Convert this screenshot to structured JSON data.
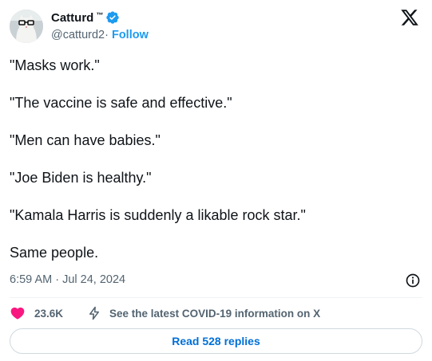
{
  "author": {
    "display_name": "Catturd",
    "tm": "™",
    "handle": "@catturd2",
    "separator": " ·",
    "follow_label": "Follow"
  },
  "tweet": {
    "lines": [
      "\"Masks work.\"",
      "\"The vaccine is safe and effective.\"",
      "\"Men can have babies.\"",
      "\"Joe Biden is healthy.\"",
      "\"Kamala Harris is suddenly a likable rock star.\"",
      "Same people."
    ]
  },
  "meta": {
    "timestamp": "6:59 AM · Jul 24, 2024"
  },
  "actions": {
    "like_count": "23.6K",
    "covid_info": "See the latest COVID-19 information on X",
    "read_replies": "Read 528 replies"
  },
  "icons": {
    "verified": "verified-badge-icon",
    "logo": "x-logo-icon",
    "info": "info-icon",
    "like": "heart-icon",
    "covid": "bolt-icon"
  },
  "colors": {
    "accent": "#1d9bf0",
    "like": "#f91880",
    "text": "#0f1419",
    "muted": "#536471",
    "replies": "#006fd6"
  }
}
